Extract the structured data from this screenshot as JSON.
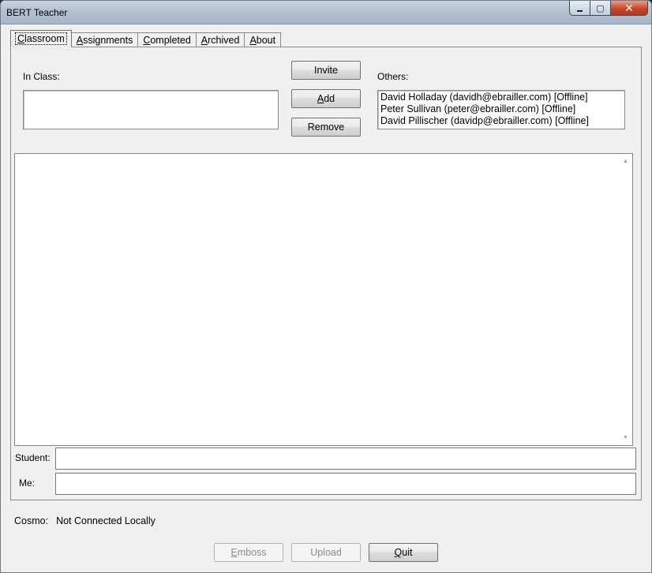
{
  "window": {
    "title": "BERT Teacher",
    "controls": {
      "minimize": "▬",
      "maximize": "▢",
      "close": "✕"
    }
  },
  "tabs": [
    {
      "label": "Classroom",
      "active": true
    },
    {
      "label": "Assignments",
      "active": false
    },
    {
      "label": "Completed",
      "active": false
    },
    {
      "label": "Archived",
      "active": false
    },
    {
      "label": "About",
      "active": false
    }
  ],
  "classroom": {
    "in_class_label": "In Class:",
    "in_class_items": [],
    "others_label": "Others:",
    "others_items": [
      "David Holladay (davidh@ebrailler.com) [Offline]",
      "Peter Sullivan (peter@ebrailler.com) [Offline]",
      "David Pillischer (davidp@ebrailler.com) [Offline]"
    ],
    "buttons": {
      "invite": "Invite",
      "add": "Add",
      "remove": "Remove"
    },
    "student_label": "Student:",
    "student_value": "",
    "me_label": "Me:",
    "me_value": ""
  },
  "status": {
    "cosmo_label": "Cosmo:",
    "cosmo_value": "Not Connected Locally"
  },
  "footer": {
    "emboss": "Emboss",
    "upload": "Upload",
    "quit": "Quit"
  }
}
